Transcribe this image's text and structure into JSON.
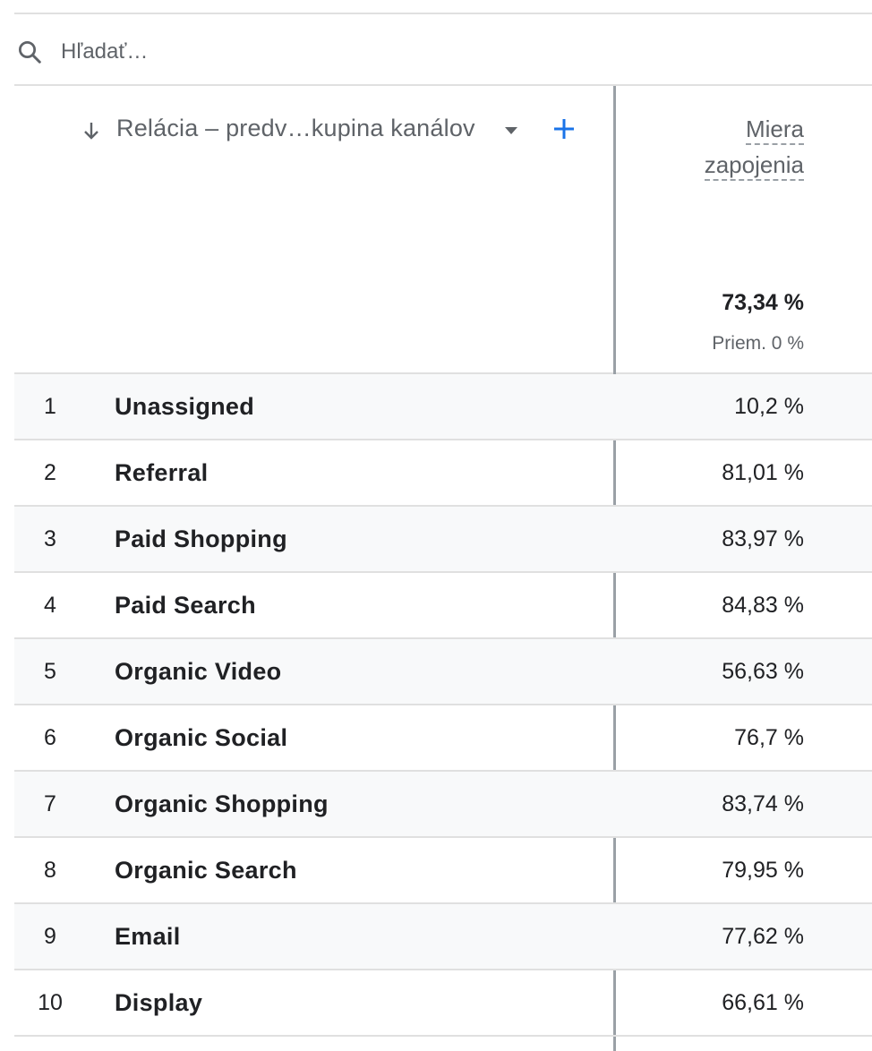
{
  "search": {
    "placeholder": "Hľadať…"
  },
  "header": {
    "dimension_label": "Relácia – predv…kupina kanálov",
    "metric_title_line1": "Miera",
    "metric_title_line2": "zapojenia",
    "total": "73,34 %",
    "average": "Priem. 0 %"
  },
  "icons": {
    "search": "search-icon",
    "sort": "arrow-down-icon",
    "dropdown": "caret-down-icon",
    "add": "plus-icon"
  },
  "colors": {
    "accent": "#1a73e8",
    "row_alt": "#f8f9fa",
    "divider": "#e0e0e0"
  },
  "rows": [
    {
      "index": "1",
      "name": "Unassigned",
      "value": "10,2 %"
    },
    {
      "index": "2",
      "name": "Referral",
      "value": "81,01 %"
    },
    {
      "index": "3",
      "name": "Paid Shopping",
      "value": "83,97 %"
    },
    {
      "index": "4",
      "name": "Paid Search",
      "value": "84,83 %"
    },
    {
      "index": "5",
      "name": "Organic Video",
      "value": "56,63 %"
    },
    {
      "index": "6",
      "name": "Organic Social",
      "value": "76,7 %"
    },
    {
      "index": "7",
      "name": "Organic Shopping",
      "value": "83,74 %"
    },
    {
      "index": "8",
      "name": "Organic Search",
      "value": "79,95 %"
    },
    {
      "index": "9",
      "name": "Email",
      "value": "77,62 %"
    },
    {
      "index": "10",
      "name": "Display",
      "value": "66,61 %"
    }
  ]
}
